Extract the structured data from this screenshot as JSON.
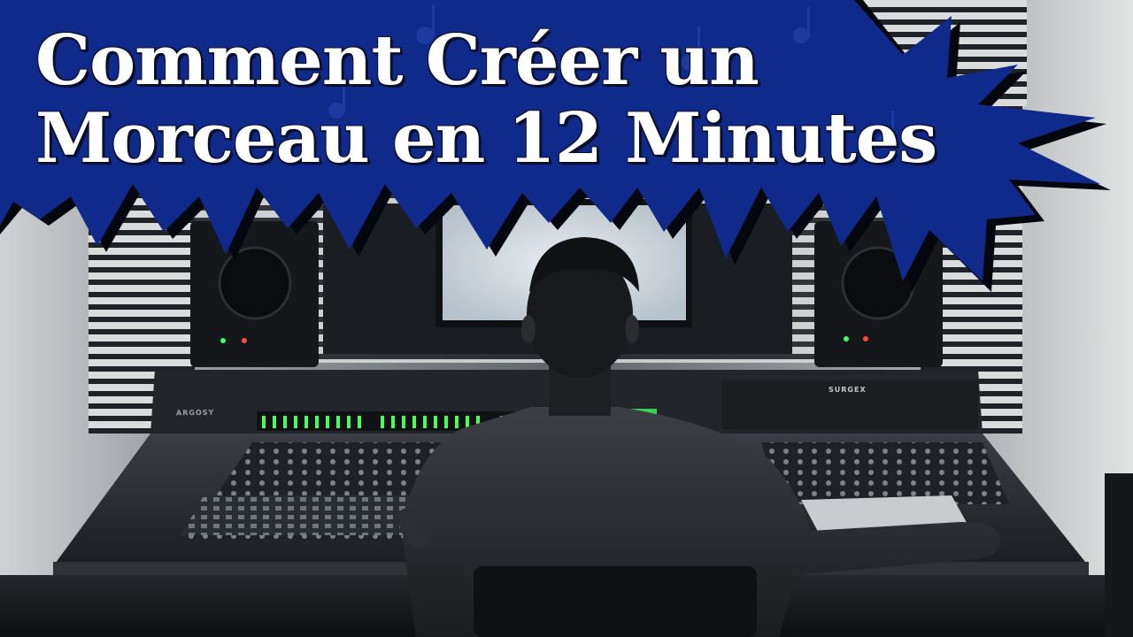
{
  "banner": {
    "title_line_1": "Comment Créer un",
    "title_line_2": "Morceau en 12 Minutes",
    "background_color": "#0f2a8a",
    "text_color": "#ffffff"
  },
  "photo": {
    "subject": "person-at-mixing-console",
    "console_brand_left": "ARGOSY",
    "console_brand_right": "SURGEX"
  }
}
